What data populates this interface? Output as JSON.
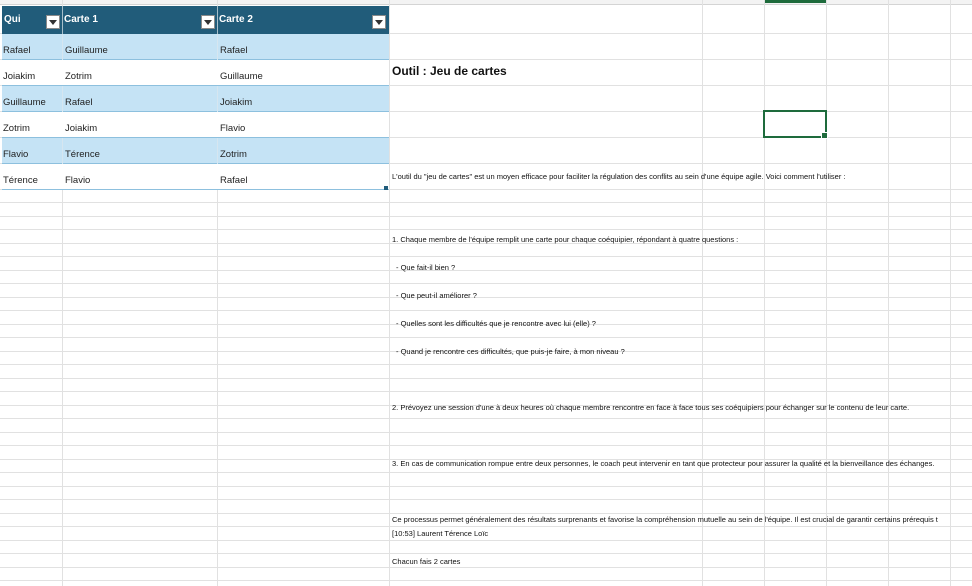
{
  "table": {
    "headers": [
      "Qui",
      "Carte 1",
      "Carte 2"
    ],
    "rows": [
      [
        "Rafael",
        "Guillaume",
        "Rafael"
      ],
      [
        "Joiakim",
        "Zotrim",
        "Guillaume"
      ],
      [
        "Guillaume",
        "Rafael",
        "Joiakim"
      ],
      [
        "Zotrim",
        "Joiakim",
        "Flavio"
      ],
      [
        "Flavio",
        "Térence",
        "Zotrim"
      ],
      [
        "Térence",
        "Flavio",
        "Rafael"
      ]
    ]
  },
  "doc": {
    "title": "Outil : Jeu de cartes",
    "intro": "L'outil du \"jeu de cartes\" est un moyen efficace pour faciliter la régulation des conflits au sein d'une équipe agile. Voici comment l'utiliser :",
    "step1": "1. Chaque membre de l'équipe remplit une carte pour chaque coéquipier, répondant à quatre questions :",
    "q1": "- Que fait-il bien ?",
    "q2": "- Que peut-il améliorer ?",
    "q3": "- Quelles sont les difficultés que je rencontre avec lui (elle) ?",
    "q4": "- Quand je rencontre ces difficultés, que puis-je faire, à mon niveau ?",
    "step2": "2. Prévoyez une session d'une à deux heures où chaque membre rencontre en face à face tous ses coéquipiers pour échanger sur le contenu de leur carte.",
    "step3": "3. En cas de communication rompue entre deux personnes, le coach peut intervenir en tant que protecteur pour assurer la qualité et la bienveillance des échanges.",
    "conclusion": "Ce processus permet généralement des résultats surprenants et favorise la compréhension mutuelle au sein de l'équipe. Il est crucial de garantir certains prérequis t",
    "chat_line": "[10:53] Laurent Térence Loïc",
    "note": "Chacun fais 2 cartes"
  },
  "colors": {
    "header_bg": "#215c7a",
    "band_bg": "#c5e3f5",
    "selection": "#1e6b3c",
    "gridline": "#e1e1e1"
  }
}
